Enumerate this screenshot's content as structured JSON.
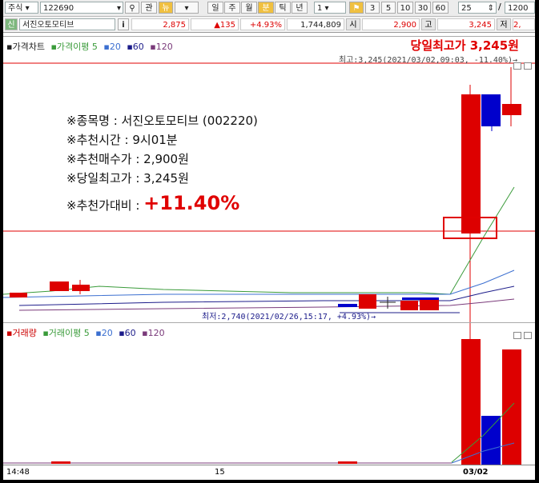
{
  "toolbar": {
    "market_select": "주식",
    "code_field": "122690",
    "btn_gwan": "관",
    "btn_yu": "뉴",
    "periods": [
      "일",
      "주",
      "월",
      "분",
      "틱",
      "년"
    ],
    "interval_select": "1",
    "minutes": [
      "3",
      "5",
      "10",
      "30",
      "60"
    ],
    "count_field": "25",
    "total_field": "1200"
  },
  "quote": {
    "sin_badge": "신",
    "stock_name": "서진오토모티브",
    "info_btn": "i",
    "last_price": "2,875",
    "change": "▲135",
    "change_rate": "+4.93%",
    "volume": "1,744,809",
    "open_label": "시",
    "open": "2,900",
    "high_label": "고",
    "high": "3,245",
    "low_label": "저",
    "low_partial": "2,"
  },
  "price_panel": {
    "legend": [
      {
        "text": "▪가격차트",
        "color": "#222222"
      },
      {
        "text": "▪가격이평 5",
        "color": "#3a9b3a"
      },
      {
        "text": "▪20",
        "color": "#3b6fd0"
      },
      {
        "text": "▪60",
        "color": "#1c1c8a"
      },
      {
        "text": "▪120",
        "color": "#7a3a7a"
      }
    ],
    "headline": "당일최고가 3,245원",
    "high_marker": "최고:3,245(2021/03/02,09:03, -11.40%)→",
    "low_marker": "최저:2,740(2021/02/26,15:17, +4.93%)→"
  },
  "annotations": {
    "line1": "※종목명 : 서진오토모티브 (002220)",
    "line2": "※추천시간 : 9시01분",
    "line3": "※추천매수가 : 2,900원",
    "line4": "※당일최고가 : 3,245원",
    "line5_prefix": "※추천가대비 : ",
    "line5_value": "+11.40%"
  },
  "volume_panel": {
    "legend": [
      {
        "text": "▪거래량",
        "color": "#cc0000"
      },
      {
        "text": "▪거래이평 5",
        "color": "#3a9b3a"
      },
      {
        "text": "▪20",
        "color": "#3b6fd0"
      },
      {
        "text": "▪60",
        "color": "#1c1c8a"
      },
      {
        "text": "▪120",
        "color": "#7a3a7a"
      }
    ]
  },
  "xaxis": {
    "labels": [
      "14:48",
      "15",
      "03/02"
    ]
  },
  "colors": {
    "up": "#dd0000",
    "down": "#0000cc",
    "accent_red": "#e00000"
  }
}
